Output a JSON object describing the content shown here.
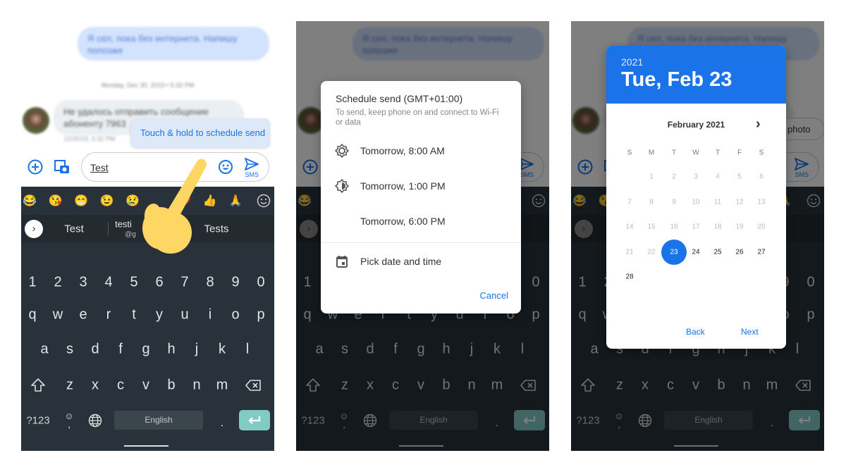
{
  "chat": {
    "outgoing_message": "Я сел, пока без интернета. Напишу попозже",
    "date_separator": "Monday, Dec 30, 2019 • 5:32 PM",
    "incoming_message": "Не удалось отправить сообщение абоненту 7963",
    "incoming_time": "12/30/19, 5:32 PM",
    "tooltip": "Touch & hold to schedule send",
    "compose_text": "Test",
    "send_label": "SMS",
    "photo_chip": "photo"
  },
  "keyboard": {
    "emojis": [
      "😂",
      "😘",
      "😁",
      "😉",
      "😢",
      "",
      "❤️",
      "👍",
      "🙏"
    ],
    "suggestions": [
      "Test",
      "testi",
      "Tests"
    ],
    "suggestion_sub": "@g",
    "rows": [
      [
        "1",
        "2",
        "3",
        "4",
        "5",
        "6",
        "7",
        "8",
        "9",
        "0"
      ],
      [
        "q",
        "w",
        "e",
        "r",
        "t",
        "y",
        "u",
        "i",
        "o",
        "p"
      ],
      [
        "a",
        "s",
        "d",
        "f",
        "g",
        "h",
        "j",
        "k",
        "l"
      ],
      [
        "z",
        "x",
        "c",
        "v",
        "b",
        "n",
        "m"
      ]
    ],
    "symbols_key": "?123",
    "space_label": "English",
    "period": ".",
    "enter_color": "#80cbc4"
  },
  "schedule_dialog": {
    "title": "Schedule send (GMT+01:00)",
    "subtitle": "To send, keep phone on and connect to Wi-Fi or data",
    "options": [
      {
        "label": "Tomorrow, 8:00 AM",
        "icon": "sun-icon"
      },
      {
        "label": "Tomorrow, 1:00 PM",
        "icon": "half-sun-icon"
      },
      {
        "label": "Tomorrow, 6:00 PM",
        "icon": "moon-icon"
      }
    ],
    "pick_label": "Pick date and time",
    "cancel_label": "Cancel"
  },
  "date_picker": {
    "year": "2021",
    "selected_date": "Tue, Feb 23",
    "month_label": "February 2021",
    "weekdays": [
      "S",
      "M",
      "T",
      "W",
      "T",
      "F",
      "S"
    ],
    "first_weekday_index": 1,
    "days_in_month": 28,
    "selected_day": 23,
    "back_label": "Back",
    "next_label": "Next",
    "accent": "#1a73e8"
  }
}
